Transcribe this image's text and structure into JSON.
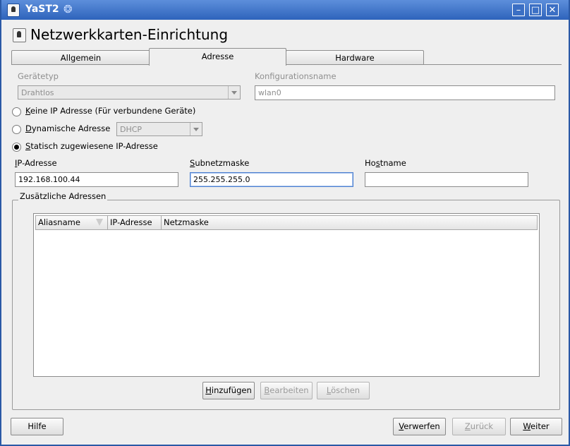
{
  "window": {
    "title": "YaST2",
    "swirl": "❂",
    "minimize": "–",
    "maximize": "□",
    "close": "✕"
  },
  "heading": "Netzwerkkarten-Einrichtung",
  "tabs": [
    {
      "label": "Allgemein"
    },
    {
      "label": "Adresse"
    },
    {
      "label": "Hardware"
    }
  ],
  "device_type": {
    "label": "Gerätetyp",
    "value": "Drahtlos"
  },
  "config_name": {
    "label": "Konfigurationsname",
    "value": "wlan0"
  },
  "radios": {
    "no_ip": {
      "label_first": "K",
      "label_rest": "eine IP Adresse (Für verbundene Geräte)"
    },
    "dynamic": {
      "label_first": "D",
      "label_rest": "ynamische Adresse",
      "combo_value": "DHCP"
    },
    "static": {
      "label_first": "S",
      "label_rest": "tatisch zugewiesene IP-Adresse"
    }
  },
  "fields": {
    "ip": {
      "label_first": "I",
      "label_rest": "P-Adresse",
      "value": "192.168.100.44"
    },
    "subnet": {
      "label_first": "S",
      "label_rest": "ubnetzmaske",
      "value": "255.255.255.0"
    },
    "hostname": {
      "label_first": "Ho",
      "label_mid": "s",
      "label_rest": "tname",
      "value": ""
    }
  },
  "additional": {
    "title": "Zusätzliche Adressen",
    "columns": [
      "Aliasname",
      "IP-Adresse",
      "Netzmaske"
    ],
    "rows": []
  },
  "group_buttons": {
    "add": {
      "first": "H",
      "rest": "inzufügen"
    },
    "edit": {
      "first": "B",
      "rest": "earbeiten"
    },
    "delete": {
      "first": "L",
      "rest": "öschen"
    }
  },
  "footer": {
    "help": "Hilfe",
    "discard": {
      "first": "V",
      "rest": "erwerfen"
    },
    "back": {
      "first": "Z",
      "rest": "urück"
    },
    "next": {
      "first": "W",
      "rest": "eiter"
    }
  }
}
